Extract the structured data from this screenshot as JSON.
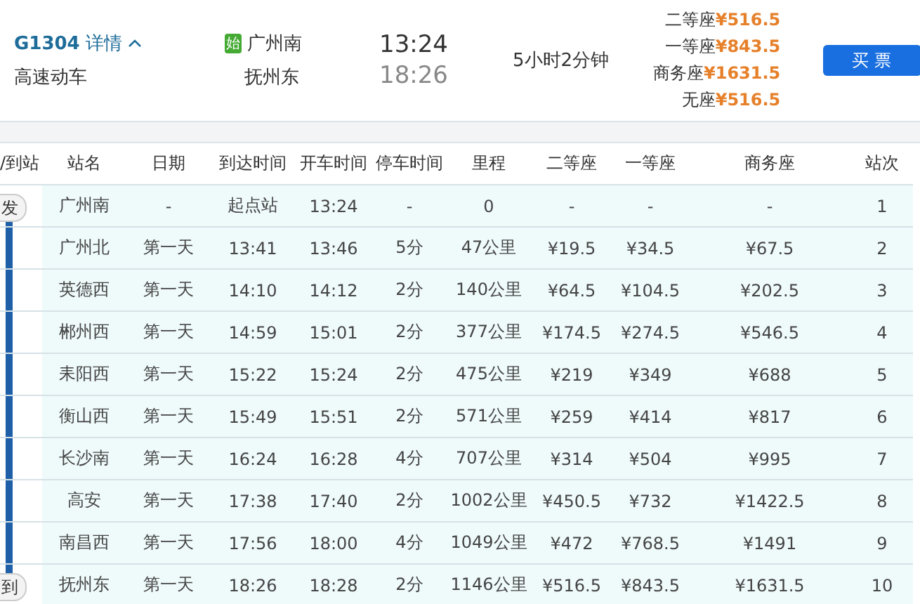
{
  "train": {
    "number": "G1304",
    "details_link": "详情",
    "type": "高速动车",
    "origin_badge": "始",
    "origin": "广州南",
    "destination": "抚州东",
    "depart": "13:24",
    "arrive": "18:26",
    "duration": "5小时2分钟",
    "fares": [
      {
        "seat": "二等座",
        "price": "¥516.5"
      },
      {
        "seat": "一等座",
        "price": "¥843.5"
      },
      {
        "seat": "商务座",
        "price": "¥1631.5"
      },
      {
        "seat": "无座",
        "price": "¥516.5"
      }
    ],
    "buy_button": "买 票"
  },
  "table": {
    "columns": [
      "/到站",
      "站名",
      "日期",
      "到达时间",
      "开车时间",
      "停车时间",
      "里程",
      "二等座",
      "一等座",
      "商务座",
      "站次"
    ],
    "rows": [
      {
        "cells": [
          "发",
          "广州南",
          "-",
          "起点站",
          "13:24",
          "-",
          "0",
          "-",
          "-",
          "-",
          "1"
        ]
      },
      {
        "cells": [
          "",
          "广州北",
          "第一天",
          "13:41",
          "13:46",
          "5分",
          "47公里",
          "¥19.5",
          "¥34.5",
          "¥67.5",
          "2"
        ]
      },
      {
        "cells": [
          "",
          "英德西",
          "第一天",
          "14:10",
          "14:12",
          "2分",
          "140公里",
          "¥64.5",
          "¥104.5",
          "¥202.5",
          "3"
        ]
      },
      {
        "cells": [
          "",
          "郴州西",
          "第一天",
          "14:59",
          "15:01",
          "2分",
          "377公里",
          "¥174.5",
          "¥274.5",
          "¥546.5",
          "4"
        ]
      },
      {
        "cells": [
          "",
          "耒阳西",
          "第一天",
          "15:22",
          "15:24",
          "2分",
          "475公里",
          "¥219",
          "¥349",
          "¥688",
          "5"
        ]
      },
      {
        "cells": [
          "",
          "衡山西",
          "第一天",
          "15:49",
          "15:51",
          "2分",
          "571公里",
          "¥259",
          "¥414",
          "¥817",
          "6"
        ]
      },
      {
        "cells": [
          "",
          "长沙南",
          "第一天",
          "16:24",
          "16:28",
          "4分",
          "707公里",
          "¥314",
          "¥504",
          "¥995",
          "7"
        ]
      },
      {
        "cells": [
          "",
          "高安",
          "第一天",
          "17:38",
          "17:40",
          "2分",
          "1002公里",
          "¥450.5",
          "¥732",
          "¥1422.5",
          "8"
        ]
      },
      {
        "cells": [
          "",
          "南昌西",
          "第一天",
          "17:56",
          "18:00",
          "4分",
          "1049公里",
          "¥472",
          "¥768.5",
          "¥1491",
          "9"
        ]
      },
      {
        "cells": [
          "到",
          "抚州东",
          "第一天",
          "18:26",
          "18:28",
          "2分",
          "1146公里",
          "¥516.5",
          "¥843.5",
          "¥1631.5",
          "10"
        ]
      }
    ]
  }
}
